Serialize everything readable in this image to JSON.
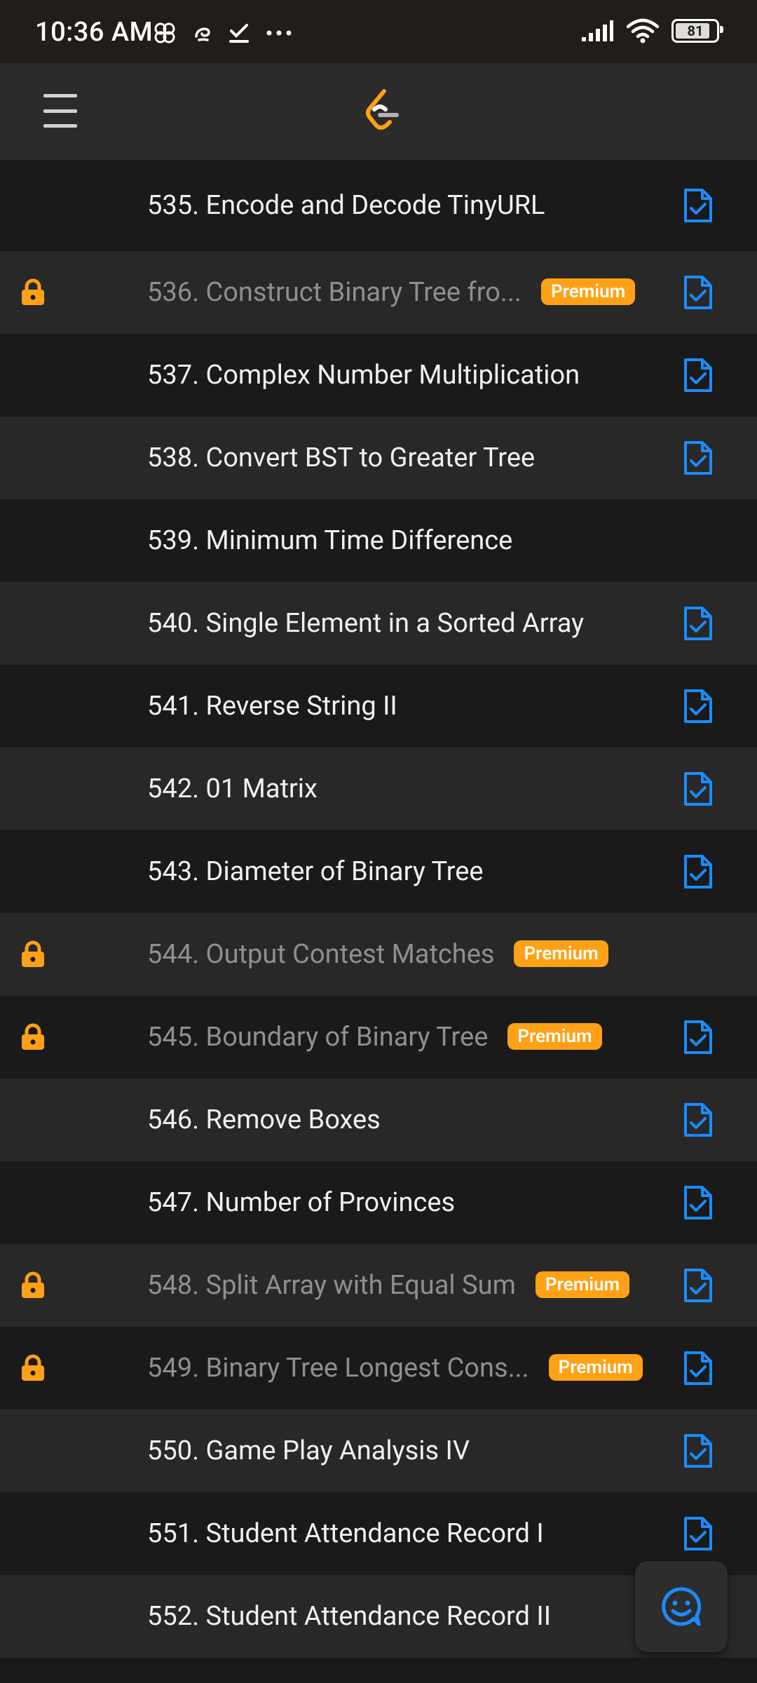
{
  "status_bar": {
    "time": "10:36 AM",
    "battery": "81",
    "icons": [
      "pinwheel-icon",
      "swirl-icon",
      "checkmark-icon",
      "more-dots-icon",
      "signal-icon",
      "wifi-icon",
      "battery-icon"
    ]
  },
  "app_bar": {
    "menu_icon": "hamburger-menu-icon",
    "logo": "leetcode-logo"
  },
  "colors": {
    "accent": "#ffa116",
    "solution_icon": "#1a8cff",
    "row_dark": "#1a1a1a",
    "row_light": "#282828"
  },
  "problems": [
    {
      "title": "535. Encode and Decode TinyURL",
      "locked": false,
      "premium": false,
      "solution": true
    },
    {
      "title": "536. Construct Binary Tree fro...",
      "locked": true,
      "premium": true,
      "solution": true
    },
    {
      "title": "537. Complex Number Multiplication",
      "locked": false,
      "premium": false,
      "solution": true
    },
    {
      "title": "538. Convert BST to Greater Tree",
      "locked": false,
      "premium": false,
      "solution": true
    },
    {
      "title": "539. Minimum Time Difference",
      "locked": false,
      "premium": false,
      "solution": false
    },
    {
      "title": "540. Single Element in a Sorted Array",
      "locked": false,
      "premium": false,
      "solution": true
    },
    {
      "title": "541. Reverse String II",
      "locked": false,
      "premium": false,
      "solution": true
    },
    {
      "title": "542. 01 Matrix",
      "locked": false,
      "premium": false,
      "solution": true
    },
    {
      "title": "543. Diameter of Binary Tree",
      "locked": false,
      "premium": false,
      "solution": true
    },
    {
      "title": "544. Output Contest Matches",
      "locked": true,
      "premium": true,
      "solution": false
    },
    {
      "title": "545. Boundary of Binary Tree",
      "locked": true,
      "premium": true,
      "solution": true
    },
    {
      "title": "546. Remove Boxes",
      "locked": false,
      "premium": false,
      "solution": true
    },
    {
      "title": "547. Number of Provinces",
      "locked": false,
      "premium": false,
      "solution": true
    },
    {
      "title": "548. Split Array with Equal Sum",
      "locked": true,
      "premium": true,
      "solution": true
    },
    {
      "title": "549. Binary Tree Longest Cons...",
      "locked": true,
      "premium": true,
      "solution": true
    },
    {
      "title": "550. Game Play Analysis IV",
      "locked": false,
      "premium": false,
      "solution": true
    },
    {
      "title": "551. Student Attendance Record I",
      "locked": false,
      "premium": false,
      "solution": true
    },
    {
      "title": "552. Student Attendance Record II",
      "locked": false,
      "premium": false,
      "solution": false
    }
  ],
  "premium_label": "Premium",
  "fab": {
    "icon": "chat-smiley-icon"
  }
}
